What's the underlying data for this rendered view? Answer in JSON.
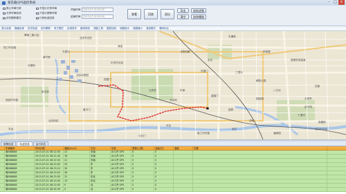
{
  "window": {
    "title": "某车载GPS监控系统"
  },
  "controls": {
    "checkboxes": [
      "禁止车辆行驶",
      "长停车辆检测",
      "实时跟踪模式",
      "不显示已停车辆",
      "只显示报警车辆",
      "行驶轨迹回放"
    ],
    "start_label": "开始时间",
    "end_label": "结束时间",
    "start_value": "2013-07-01 00:00",
    "end_value": "2013-07-02 00:00",
    "buttons": {
      "query": "查看",
      "play": "回放",
      "stop": "退出",
      "export": "导出",
      "clear": "清空",
      "add_track": "加轨迹路",
      "fast": "加快播放"
    }
  },
  "links": [
    "显示全部",
    "隐藏全部",
    "历史轨迹",
    "实时跟踪",
    "电子围栏",
    "区域查车",
    "路线规划",
    "测距工具",
    "图层控制",
    "地图放大",
    "地图缩小",
    "漫游模式",
    "清除标注"
  ],
  "map_labels": [
    "翠微二期小区",
    "西三环北路",
    "北京东北旺",
    "天通苑",
    "安贞",
    "中关村大街",
    "长春桥",
    "北辰西路",
    "海淀",
    "航天桥",
    "北京动物园",
    "西直门",
    "北京站",
    "朝阳公园",
    "天坛",
    "复兴门",
    "国贸",
    "东直门",
    "三里屯",
    "首都机场高速",
    "团结湖",
    "劲松",
    "双井",
    "十里河",
    "南三环东路",
    "西四环中路",
    "万泉河",
    "紫竹院",
    "北京西站",
    "丰台",
    "大郊亭",
    "北京欢乐谷",
    "八王坟",
    "四惠",
    "百子湾",
    "潘家园",
    "南磨房",
    "小红门",
    "王府井",
    "东单",
    "建国门",
    "呼家楼"
  ],
  "tabs": [
    "报警信息",
    "轨迹信息",
    "运行状态"
  ],
  "table": {
    "headers": [
      "",
      "车辆编号",
      "时间日期",
      "速度(km/h)",
      "方向",
      "状态",
      "里程(公里)",
      "油量(升)",
      "温度",
      "位置"
    ],
    "rows": [
      [
        "",
        "粤B88888",
        "2013-07-01 08:12:30",
        "12",
        "东南",
        "ACC开 GPS",
        "0",
        "0",
        "",
        ""
      ],
      [
        "",
        "粤B88888",
        "2013-07-01 08:12:40",
        "18",
        "东南",
        "ACC开 GPS",
        "0",
        "0",
        "",
        ""
      ],
      [
        "",
        "粤B88888",
        "2013-07-01 08:12:50",
        "21",
        "东南",
        "ACC开 GPS",
        "0",
        "0",
        "",
        ""
      ],
      [
        "",
        "粤B88888",
        "2013-07-01 08:13:00",
        "25",
        "东",
        "ACC开 GPS",
        "0",
        "0",
        "",
        ""
      ],
      [
        "",
        "粤B88888",
        "2013-07-01 08:13:10",
        "30",
        "东",
        "ACC开 GPS",
        "0",
        "0",
        "",
        ""
      ],
      [
        "",
        "粤B88888",
        "2013-07-01 08:13:20",
        "28",
        "东",
        "ACC开 GPS",
        "0",
        "0",
        "",
        ""
      ],
      [
        "",
        "粤B88888",
        "2013-07-01 08:13:30",
        "22",
        "东北",
        "ACC开 GPS",
        "0",
        "0",
        "",
        ""
      ],
      [
        "",
        "粤B88888",
        "2013-07-01 08:13:40",
        "15",
        "东北",
        "ACC开 GPS",
        "0",
        "0",
        "",
        ""
      ],
      [
        "",
        "粤B88888",
        "2013-07-01 08:13:50",
        "9",
        "北",
        "ACC开 GPS",
        "0",
        "0",
        "",
        ""
      ],
      [
        "",
        "粤B88888",
        "2013-07-01 08:14:00",
        "0",
        "北",
        "ACC开 GPS",
        "0",
        "0",
        "",
        ""
      ]
    ]
  },
  "colors": {
    "track": "#e0282a",
    "header": "#f3ad3e",
    "row": "#bfe6a6",
    "road": "#f7f2e2",
    "water": "#a9c6e8"
  }
}
